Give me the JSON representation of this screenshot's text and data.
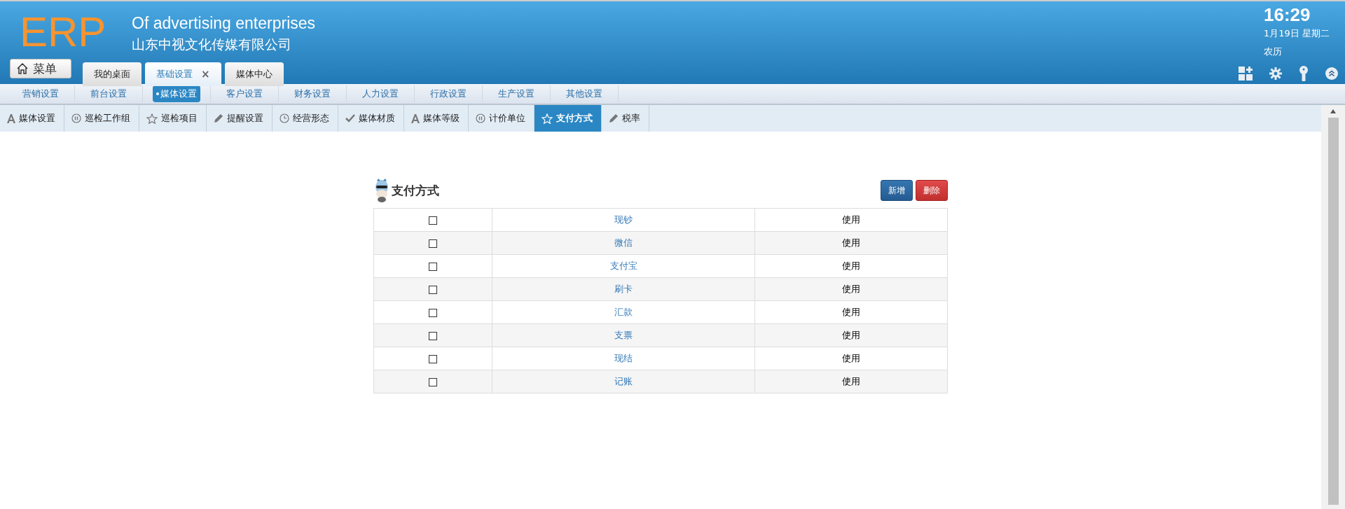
{
  "header": {
    "logo": "ERP",
    "subtitle": "Of advertising enterprises",
    "company": "山东中视文化传媒有限公司",
    "menu_button": "菜单",
    "tabs": [
      {
        "label": "我的桌面",
        "selected": false,
        "closable": false
      },
      {
        "label": "基础设置",
        "selected": true,
        "closable": true
      },
      {
        "label": "媒体中心",
        "selected": false,
        "closable": false
      }
    ],
    "close_mark": "×",
    "clock": {
      "time": "16:29",
      "date": "1月19日 星期二",
      "lunar": "农历"
    }
  },
  "nav": [
    {
      "label": "营销设置",
      "selected": false
    },
    {
      "label": "前台设置",
      "selected": false
    },
    {
      "label": "媒体设置",
      "selected": true
    },
    {
      "label": "客户设置",
      "selected": false
    },
    {
      "label": "财务设置",
      "selected": false
    },
    {
      "label": "人力设置",
      "selected": false
    },
    {
      "label": "行政设置",
      "selected": false
    },
    {
      "label": "生产设置",
      "selected": false
    },
    {
      "label": "其他设置",
      "selected": false
    }
  ],
  "subtabs": [
    {
      "label": "媒体设置",
      "kind": "font",
      "selected": false
    },
    {
      "label": "巡检工作组",
      "kind": "pause",
      "selected": false
    },
    {
      "label": "巡检项目",
      "kind": "star",
      "selected": false
    },
    {
      "label": "提醒设置",
      "kind": "pencil",
      "selected": false
    },
    {
      "label": "经营形态",
      "kind": "clock",
      "selected": false
    },
    {
      "label": "媒体材质",
      "kind": "check",
      "selected": false
    },
    {
      "label": "媒体等级",
      "kind": "font",
      "selected": false
    },
    {
      "label": "计价单位",
      "kind": "pause",
      "selected": false
    },
    {
      "label": "支付方式",
      "kind": "star",
      "selected": true
    },
    {
      "label": "税率",
      "kind": "pencil",
      "selected": false
    }
  ],
  "panel": {
    "title": "支付方式",
    "buttons": [
      {
        "label": "新增",
        "kind": "primary"
      },
      {
        "label": "删除",
        "kind": "danger"
      }
    ],
    "rows": [
      {
        "checked": false,
        "name": "现钞",
        "status": "使用"
      },
      {
        "checked": false,
        "name": "微信",
        "status": "使用"
      },
      {
        "checked": false,
        "name": "支付宝",
        "status": "使用"
      },
      {
        "checked": false,
        "name": "刷卡",
        "status": "使用"
      },
      {
        "checked": false,
        "name": "汇款",
        "status": "使用"
      },
      {
        "checked": false,
        "name": "支票",
        "status": "使用"
      },
      {
        "checked": false,
        "name": "现结",
        "status": "使用"
      },
      {
        "checked": false,
        "name": "记账",
        "status": "使用"
      }
    ]
  }
}
